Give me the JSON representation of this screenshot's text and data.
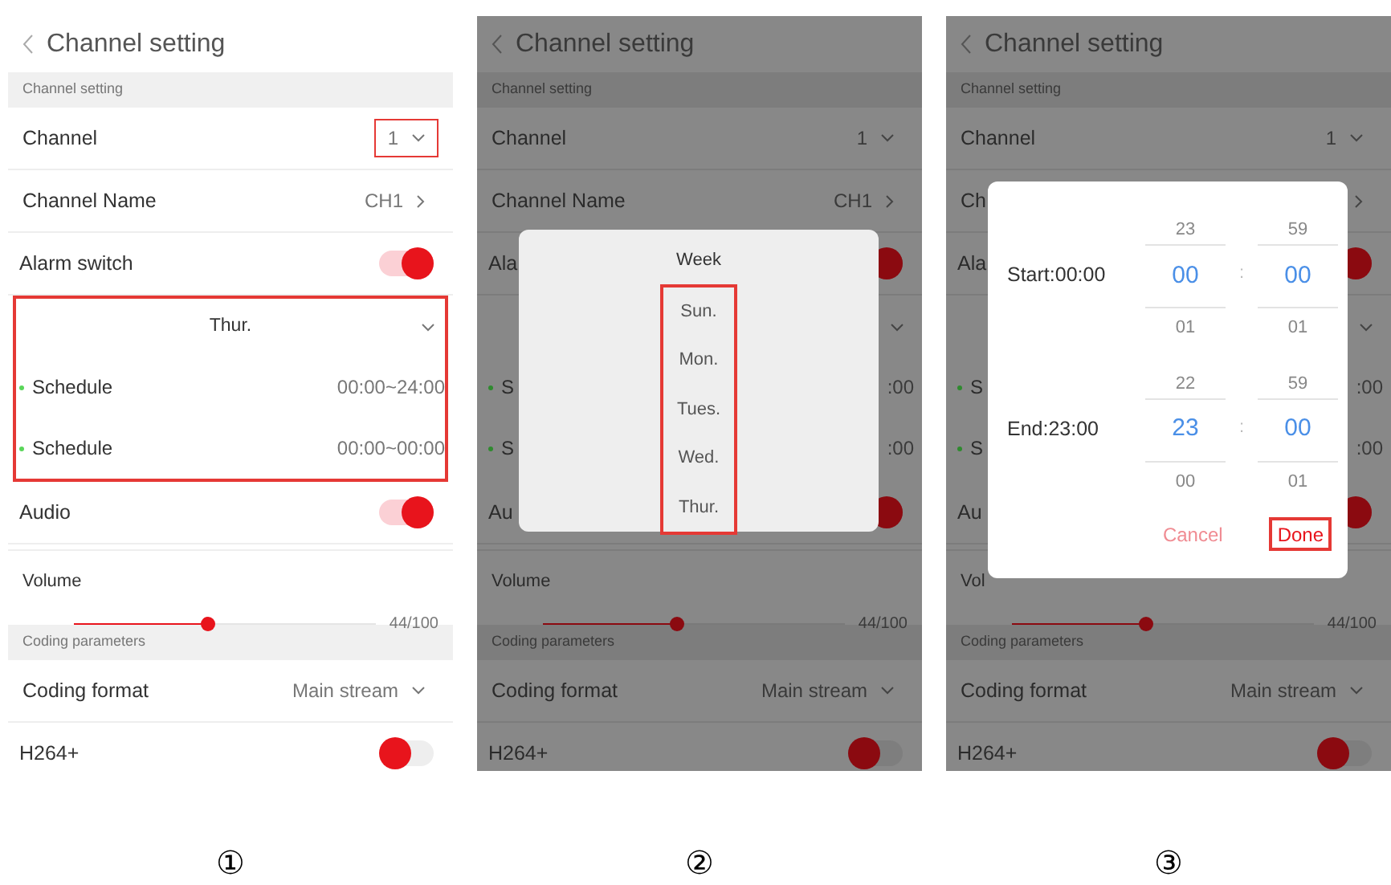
{
  "panels": [
    {
      "title": "Channel setting",
      "dimmed": false,
      "caption": "①",
      "rows": [
        {
          "kind": "section",
          "label": "Channel setting"
        },
        {
          "kind": "select",
          "label": "Channel",
          "value": "1",
          "highlighted": true
        },
        {
          "kind": "link",
          "label": "Channel Name",
          "value": "CH1"
        },
        {
          "kind": "toggle",
          "label": "Alarm switch",
          "on": true
        },
        {
          "kind": "group",
          "day": "Thur.",
          "highlighted": true,
          "schedules": [
            {
              "label": "Schedule",
              "value": "00:00~24:00"
            },
            {
              "label": "Schedule",
              "value": "00:00~00:00"
            }
          ]
        },
        {
          "kind": "toggle",
          "label": "Audio",
          "on": true
        },
        {
          "kind": "slider",
          "label": "Volume",
          "level": 0.44,
          "reading": "44/100"
        },
        {
          "kind": "section",
          "label": "Coding parameters"
        },
        {
          "kind": "select",
          "label": "Coding format",
          "value": "Main stream",
          "highlighted": false
        },
        {
          "kind": "toggle",
          "label": "H264+",
          "on": false
        }
      ]
    },
    {
      "title": "Channel setting",
      "dimmed": true,
      "caption": "②",
      "rows": [
        {
          "kind": "section",
          "label": "Channel setting"
        },
        {
          "kind": "select",
          "label": "Channel",
          "value": "1",
          "highlighted": false
        },
        {
          "kind": "link",
          "label": "Channel Name",
          "value": "CH1"
        },
        {
          "kind": "toggle",
          "label": "Ala",
          "on": true
        },
        {
          "kind": "group",
          "highlighted": false,
          "schedules": [
            {
              "label": "S",
              "value": ":00"
            },
            {
              "label": "S",
              "value": ":00"
            }
          ]
        },
        {
          "kind": "toggle",
          "label": "Au",
          "on": true
        },
        {
          "kind": "slider",
          "label": "Volume",
          "level": 0.44,
          "reading": "44/100"
        },
        {
          "kind": "section",
          "label": "Coding parameters"
        },
        {
          "kind": "select",
          "label": "Coding format",
          "value": "Main stream",
          "highlighted": false
        },
        {
          "kind": "toggle",
          "label": "H264+",
          "on": false
        }
      ],
      "dialog": {
        "kind": "week",
        "title": "Week",
        "highlighted": true,
        "options": [
          "Sun.",
          "Mon.",
          "Tues.",
          "Wed.",
          "Thur."
        ]
      }
    },
    {
      "title": "Channel setting",
      "dimmed": true,
      "caption": "③",
      "rows": [
        {
          "kind": "section",
          "label": "Channel setting"
        },
        {
          "kind": "select",
          "label": "Channel",
          "value": "1",
          "highlighted": false
        },
        {
          "kind": "link",
          "label": "Ch"
        },
        {
          "kind": "toggle",
          "label": "Ala",
          "on": true
        },
        {
          "kind": "group",
          "highlighted": false,
          "schedules": [
            {
              "label": "S",
              "value": ":00"
            },
            {
              "label": "S",
              "value": ":00"
            }
          ]
        },
        {
          "kind": "toggle",
          "label": "Au",
          "on": true
        },
        {
          "kind": "slider",
          "label": "Vol",
          "level": 0.44,
          "reading": "44/100"
        },
        {
          "kind": "section",
          "label": "Coding parameters"
        },
        {
          "kind": "select",
          "label": "Coding format",
          "value": "Main stream",
          "highlighted": false
        },
        {
          "kind": "toggle",
          "label": "H264+",
          "on": false
        }
      ],
      "dialog": {
        "kind": "time",
        "times": [
          {
            "label": "Start:00:00",
            "separator": ":",
            "hour": {
              "above": "23",
              "value": "00",
              "below": "01"
            },
            "minute": {
              "above": "59",
              "value": "00",
              "below": "01"
            }
          },
          {
            "label": "End:23:00",
            "separator": ":",
            "hour": {
              "above": "22",
              "value": "23",
              "below": "00"
            },
            "minute": {
              "above": "59",
              "value": "00",
              "below": "01"
            }
          }
        ],
        "buttons": [
          {
            "label": "Cancel",
            "primary": false,
            "highlighted": false
          },
          {
            "label": "Done",
            "primary": true,
            "highlighted": true
          }
        ]
      }
    }
  ]
}
